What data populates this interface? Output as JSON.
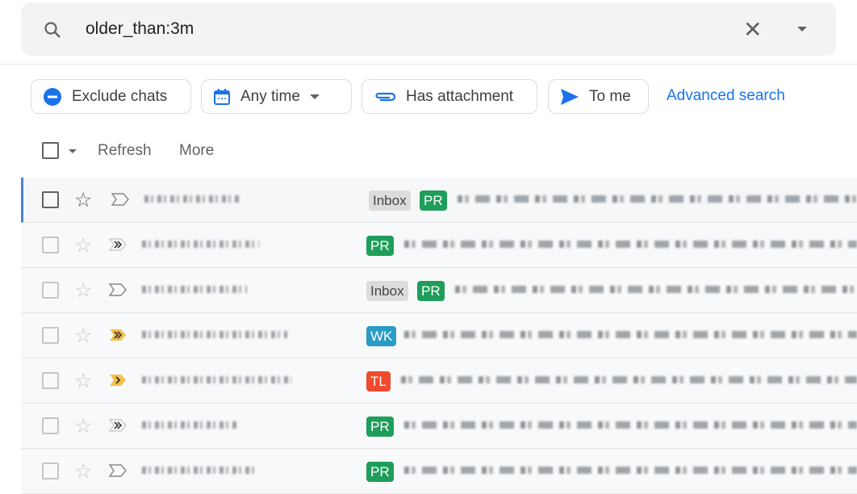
{
  "search": {
    "query": "older_than:3m",
    "icon": "search-icon",
    "clear_icon": "close-icon",
    "options_icon": "caret-down-icon"
  },
  "chips": [
    {
      "label": "Exclude chats",
      "icon": "minus-circle-icon",
      "color": "#1a73e8"
    },
    {
      "label": "Any time",
      "icon": "calendar-icon",
      "color": "#1a73e8"
    },
    {
      "label": "Has attachment",
      "icon": "paperclip-icon",
      "color": "#1a73e8"
    },
    {
      "label": "To me",
      "icon": "send-icon",
      "color": "#1a73e8"
    }
  ],
  "advanced_search": "Advanced search",
  "toolbar": {
    "refresh": "Refresh",
    "more": "More"
  },
  "label_colors": {
    "Inbox": "#dcdcdc",
    "PR": "#1e9e5a",
    "WK": "#2a9bc4",
    "TL": "#f04a2f"
  },
  "rows": [
    {
      "labels": [
        "Inbox",
        "PR"
      ],
      "importance": "outline"
    },
    {
      "labels": [
        "PR"
      ],
      "importance": "outline-double"
    },
    {
      "labels": [
        "Inbox",
        "PR"
      ],
      "importance": "outline"
    },
    {
      "labels": [
        "WK"
      ],
      "importance": "yellow-double"
    },
    {
      "labels": [
        "TL"
      ],
      "importance": "yellow-single"
    },
    {
      "labels": [
        "PR"
      ],
      "importance": "outline-double"
    },
    {
      "labels": [
        "PR"
      ],
      "importance": "outline"
    }
  ]
}
